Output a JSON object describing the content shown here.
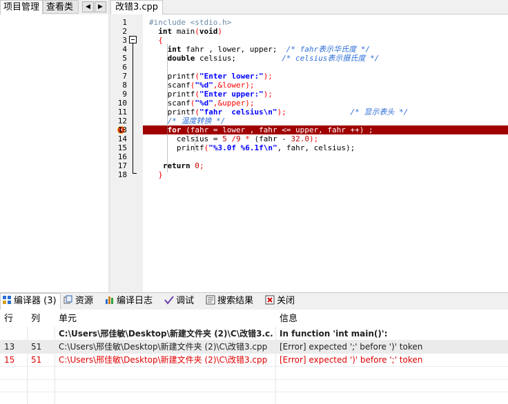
{
  "left_panel": {
    "tabs": [
      "项目管理",
      "查看类"
    ],
    "nav_prev": "◀",
    "nav_next": "▶"
  },
  "editor": {
    "file_tab": "改错3.cpp",
    "line_numbers": [
      "1",
      "2",
      "3",
      "4",
      "5",
      "6",
      "7",
      "8",
      "9",
      "10",
      "11",
      "12",
      "13",
      "14",
      "15",
      "16",
      "17",
      "18"
    ],
    "error_line": 13,
    "lines": [
      [
        {
          "t": "#include <stdio.h>",
          "c": "pp"
        }
      ],
      [
        {
          "t": "int",
          "c": "kw"
        },
        {
          "t": " main",
          "c": "plain"
        },
        {
          "t": "(",
          "c": "sym"
        },
        {
          "t": "void",
          "c": "kw"
        },
        {
          "t": ")",
          "c": "sym"
        }
      ],
      [
        {
          "t": "{",
          "c": "sym"
        }
      ],
      [
        {
          "t": "int",
          "c": "kw"
        },
        {
          "t": " fahr , lower, upper;  ",
          "c": "plain"
        },
        {
          "t": "/* fahr表示华氏度 */",
          "c": "cmt"
        }
      ],
      [
        {
          "t": "double",
          "c": "kw"
        },
        {
          "t": " celsius;          ",
          "c": "plain"
        },
        {
          "t": "/* celsius表示摄氏度 */",
          "c": "cmt"
        }
      ],
      [],
      [
        {
          "t": "printf",
          "c": "plain"
        },
        {
          "t": "(",
          "c": "sym"
        },
        {
          "t": "\"Enter lower:\"",
          "c": "str"
        },
        {
          "t": ");",
          "c": "sym"
        }
      ],
      [
        {
          "t": "scanf",
          "c": "plain"
        },
        {
          "t": "(",
          "c": "sym"
        },
        {
          "t": "\"%d\"",
          "c": "str"
        },
        {
          "t": ",&lower);",
          "c": "sym"
        }
      ],
      [
        {
          "t": "printf",
          "c": "plain"
        },
        {
          "t": "(",
          "c": "sym"
        },
        {
          "t": "\"Enter upper:\"",
          "c": "str"
        },
        {
          "t": ");",
          "c": "sym"
        }
      ],
      [
        {
          "t": "scanf",
          "c": "plain"
        },
        {
          "t": "(",
          "c": "sym"
        },
        {
          "t": "\"%d\"",
          "c": "str"
        },
        {
          "t": ",&upper);",
          "c": "sym"
        }
      ],
      [
        {
          "t": "printf",
          "c": "plain"
        },
        {
          "t": "(",
          "c": "sym"
        },
        {
          "t": "\"fahr  celsius\\n\"",
          "c": "str"
        },
        {
          "t": ");",
          "c": "sym"
        },
        {
          "t": "              ",
          "c": "plain"
        },
        {
          "t": "/* 显示表头 */",
          "c": "cmt"
        }
      ],
      [
        {
          "t": "/* 温度转换 */",
          "c": "cmt"
        }
      ],
      [
        {
          "t": "for",
          "c": "kw"
        },
        {
          "t": " (fahr = lower , fahr <= upper, fahr ++) ;",
          "c": "plain"
        }
      ],
      [
        {
          "t": "celsius = ",
          "c": "plain"
        },
        {
          "t": "5",
          "c": "num"
        },
        {
          "t": " /",
          "c": "sym"
        },
        {
          "t": "9",
          "c": "num"
        },
        {
          "t": " * ",
          "c": "sym"
        },
        {
          "t": "(fahr - ",
          "c": "plain"
        },
        {
          "t": "32.0",
          "c": "num"
        },
        {
          "t": ");",
          "c": "sym"
        }
      ],
      [
        {
          "t": "printf",
          "c": "plain"
        },
        {
          "t": "(",
          "c": "sym"
        },
        {
          "t": "\"%3.0f %6.1f\\n\"",
          "c": "str"
        },
        {
          "t": ", fahr, celsius);",
          "c": "plain"
        }
      ],
      [],
      [
        {
          "t": "return",
          "c": "kw"
        },
        {
          "t": " 0",
          "c": "num"
        },
        {
          "t": ";",
          "c": "sym"
        }
      ],
      [
        {
          "t": "}",
          "c": "sym"
        }
      ]
    ]
  },
  "bottom_tabs": {
    "compiler": "编译器 (3)",
    "resources": "资源",
    "compile_log": "编译日志",
    "debug": "调试",
    "search_results": "搜索结果",
    "close": "关闭"
  },
  "messages": {
    "headers": {
      "line": "行",
      "col": "列",
      "unit": "单元",
      "info": "信息"
    },
    "rows": [
      {
        "line": "",
        "col": "",
        "unit": "C:\\Users\\邢佳敏\\Desktop\\新建文件夹 (2)\\C\\改错3.c...",
        "info": "In function 'int main()':",
        "style": "bold"
      },
      {
        "line": "13",
        "col": "51",
        "unit": "C:\\Users\\邢佳敏\\Desktop\\新建文件夹 (2)\\C\\改错3.cpp",
        "info": "[Error] expected ';' before ')' token",
        "style": "normal"
      },
      {
        "line": "15",
        "col": "51",
        "unit": "C:\\Users\\邢佳敏\\Desktop\\新建文件夹 (2)\\C\\改错3.cpp",
        "info": "[Error] expected ')' before ';' token",
        "style": "error"
      }
    ]
  },
  "colors": {
    "error_line_bg": "#a00000",
    "error_text": "#e00000",
    "selected_row_bg": "#ebebeb"
  }
}
